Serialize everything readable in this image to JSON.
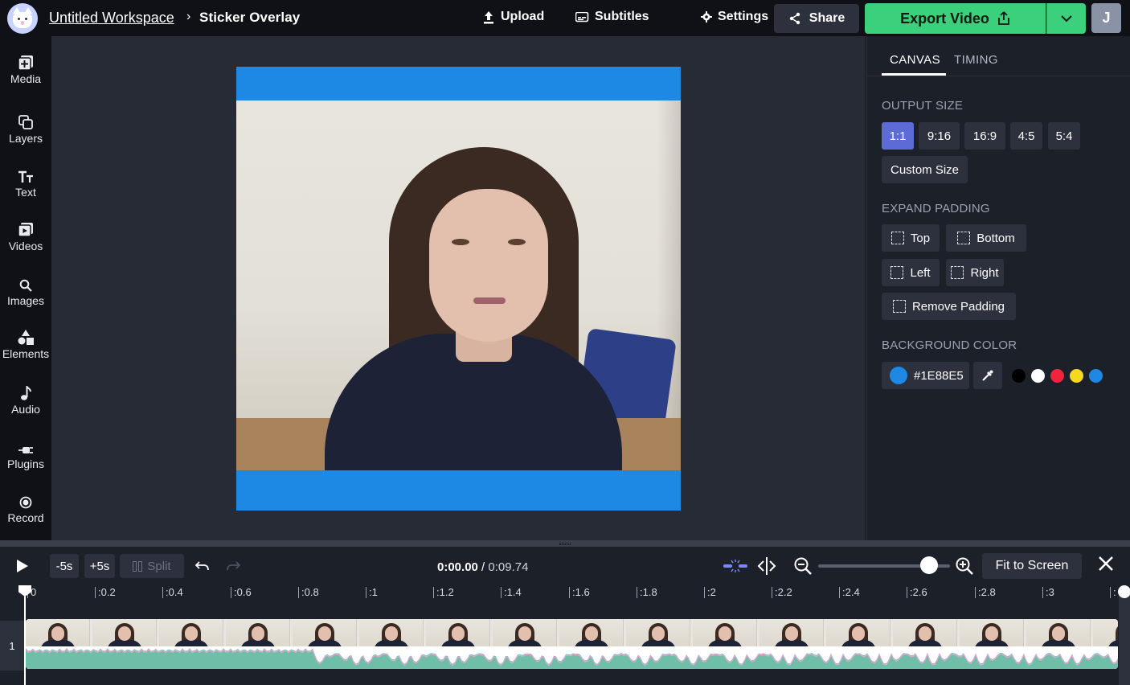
{
  "header": {
    "workspace": "Untitled Workspace",
    "separator": "›",
    "project": "Sticker Overlay",
    "upload": "Upload",
    "subtitles": "Subtitles",
    "settings": "Settings",
    "share": "Share",
    "export": "Export Video",
    "avatar_initial": "J"
  },
  "sidebar": {
    "items": [
      {
        "label": "Media",
        "icon": "media-plus-icon"
      },
      {
        "label": "Layers",
        "icon": "layers-icon"
      },
      {
        "label": "Text",
        "icon": "text-icon"
      },
      {
        "label": "Videos",
        "icon": "video-icon"
      },
      {
        "label": "Images",
        "icon": "search-icon"
      },
      {
        "label": "Elements",
        "icon": "shapes-icon"
      },
      {
        "label": "Audio",
        "icon": "music-note-icon"
      },
      {
        "label": "Plugins",
        "icon": "plug-icon"
      },
      {
        "label": "Record",
        "icon": "record-icon"
      }
    ]
  },
  "panel": {
    "tabs": [
      "CANVAS",
      "TIMING"
    ],
    "output_size_title": "OUTPUT SIZE",
    "sizes": [
      "1:1",
      "9:16",
      "16:9",
      "4:5",
      "5:4"
    ],
    "selected_size": "1:1",
    "custom_size": "Custom Size",
    "expand_padding_title": "EXPAND PADDING",
    "padding": {
      "top": "Top",
      "bottom": "Bottom",
      "left": "Left",
      "right": "Right",
      "remove": "Remove Padding"
    },
    "background_title": "BACKGROUND COLOR",
    "background_hex": "#1E88E5",
    "swatches": [
      "#000000",
      "#ffffff",
      "#f0243c",
      "#f5d820",
      "#1e88e5"
    ]
  },
  "colors": {
    "accent": "#5c6bd6",
    "export_green": "#3bd07b",
    "canvas_bg": "#1e88e5"
  },
  "timeline": {
    "minus5": "-5s",
    "plus5": "+5s",
    "split": "Split",
    "current_time": "0:00.00",
    "separator": "/",
    "total_time": "0:09.74",
    "fit_to_screen": "Fit to Screen",
    "track_number": "1",
    "ticks": [
      "0",
      ":0.2",
      ":0.4",
      ":0.6",
      ":0.8",
      ":1",
      ":1.2",
      ":1.4",
      ":1.6",
      ":1.8",
      ":2",
      ":2.2",
      ":2.4",
      ":2.6",
      ":2.8",
      ":3",
      ":"
    ]
  }
}
